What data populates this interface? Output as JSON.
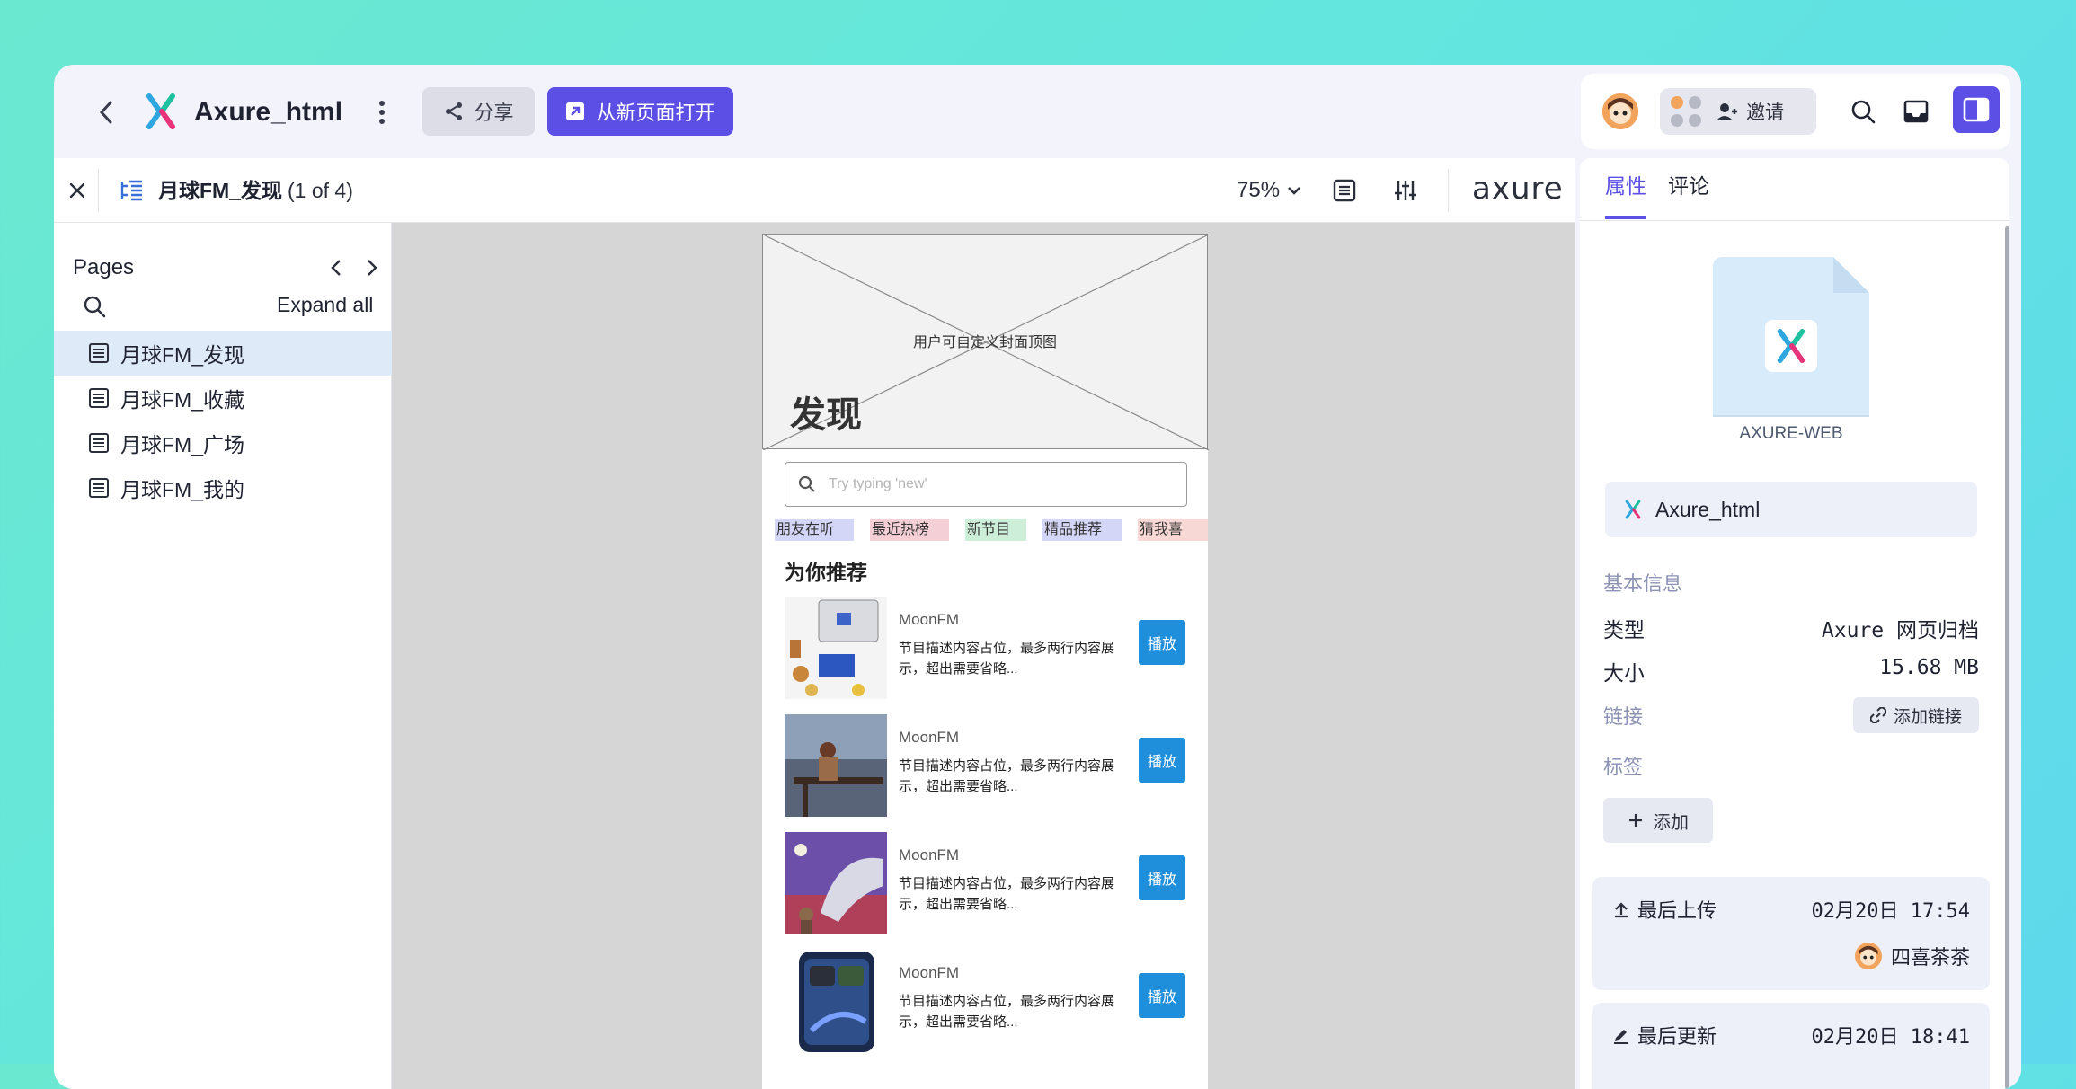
{
  "header": {
    "app_title": "Axure_html",
    "share_label": "分享",
    "open_label": "从新页面打开",
    "invite_label": "邀请"
  },
  "toolbar": {
    "page_title": "月球FM_发现",
    "page_count": "(1 of 4)",
    "zoom": "75%",
    "brand": "axure"
  },
  "sidebar": {
    "title": "Pages",
    "expand_all": "Expand all",
    "items": [
      {
        "label": "月球FM_发现",
        "active": true
      },
      {
        "label": "月球FM_收藏",
        "active": false
      },
      {
        "label": "月球FM_广场",
        "active": false
      },
      {
        "label": "月球FM_我的",
        "active": false
      }
    ]
  },
  "prototype": {
    "hero_caption": "用户可自定义封面顶图",
    "hero_title": "发现",
    "search_placeholder": "Try typing 'new'",
    "tags": [
      "朋友在听",
      "最近热榜",
      "新节目",
      "精品推荐",
      "猜我喜"
    ],
    "section_title": "为你推荐",
    "items": [
      {
        "name": "MoonFM",
        "desc": "节目描述内容占位，最多两行内容展示，超出需要省略...",
        "play": "播放"
      },
      {
        "name": "MoonFM",
        "desc": "节目描述内容占位，最多两行内容展示，超出需要省略...",
        "play": "播放"
      },
      {
        "name": "MoonFM",
        "desc": "节目描述内容占位，最多两行内容展示，超出需要省略...",
        "play": "播放"
      },
      {
        "name": "MoonFM",
        "desc": "节目描述内容占位，最多两行内容展示，超出需要省略...",
        "play": "播放"
      }
    ]
  },
  "panel": {
    "tabs": [
      "属性",
      "评论"
    ],
    "file_type_label": "AXURE-WEB",
    "file_name": "Axure_html",
    "basic_info": "基本信息",
    "type_key": "类型",
    "type_val": "Axure 网页归档",
    "size_key": "大小",
    "size_val": "15.68 MB",
    "link_key": "链接",
    "add_link": "添加链接",
    "tags_key": "标签",
    "add_tag": "添加",
    "last_upload_label": "最后上传",
    "last_upload_time": "02月20日 17:54",
    "uploader": "四喜茶茶",
    "last_update_label": "最后更新",
    "last_update_time": "02月20日 18:41"
  },
  "colors": {
    "accent": "#5b4fe6",
    "play_button": "#1f8fdb",
    "active_page": "#dfeaf8",
    "background_gradient_start": "#6be8d0",
    "background_gradient_end": "#5ed8ec"
  },
  "icons": [
    "back-arrow-icon",
    "axure-logo-icon",
    "more-vertical-icon",
    "share-icon",
    "open-external-icon",
    "search-icon",
    "inbox-icon",
    "panel-toggle-icon",
    "close-icon",
    "page-tree-icon",
    "chevron-down-icon",
    "document-icon",
    "sliders-icon",
    "link-icon",
    "plus-icon",
    "upload-icon",
    "edit-icon"
  ]
}
